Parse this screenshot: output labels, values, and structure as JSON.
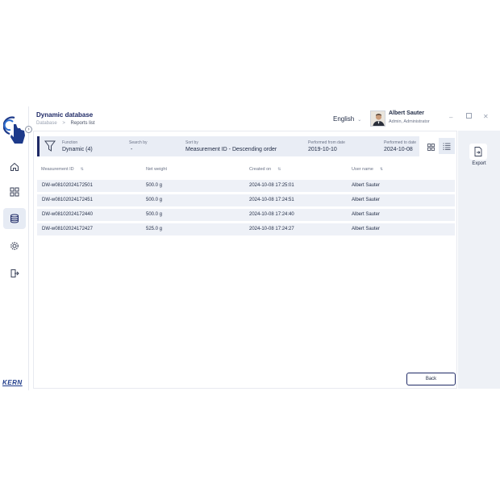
{
  "header": {
    "title": "Dynamic database",
    "breadcrumb": [
      "Database",
      "Reports list"
    ],
    "language": "English",
    "user_name": "Albert Sauter",
    "user_role": "Admin, Administrator"
  },
  "sidebar": {
    "items": [
      {
        "icon": "home-icon"
      },
      {
        "icon": "apps-grid-icon"
      },
      {
        "icon": "database-icon",
        "active": true
      },
      {
        "icon": "settings-gear-icon"
      },
      {
        "icon": "logout-icon"
      }
    ],
    "brand": "KERN"
  },
  "filters": {
    "function_label": "Function",
    "function_value": "Dynamic (4)",
    "search_label": "Search by",
    "search_value": "-",
    "sort_label": "Sort by",
    "sort_value": "Measurement ID - Descending order",
    "from_label": "Performed from date",
    "from_value": "2019-10-10",
    "to_label": "Performed to date",
    "to_value": "2024-10-08"
  },
  "table": {
    "columns": [
      "Measurement ID",
      "Net weight",
      "Created on",
      "User name"
    ],
    "rows": [
      [
        "DW-w08102024172501",
        "500.0 g",
        "2024-10-08 17:25:01",
        "Albert Sauter"
      ],
      [
        "DW-w08102024172451",
        "500.0 g",
        "2024-10-08 17:24:51",
        "Albert Sauter"
      ],
      [
        "DW-w08102024172440",
        "500.0 g",
        "2024-10-08 17:24:40",
        "Albert Sauter"
      ],
      [
        "DW-w08102024172427",
        "525.0 g",
        "2024-10-08 17:24:27",
        "Albert Sauter"
      ]
    ]
  },
  "actions": {
    "back": "Back",
    "export": "Export"
  },
  "colors": {
    "accent": "#1f2a66",
    "row_bg": "#eef1f7",
    "panel_bg": "#eef1f6"
  }
}
